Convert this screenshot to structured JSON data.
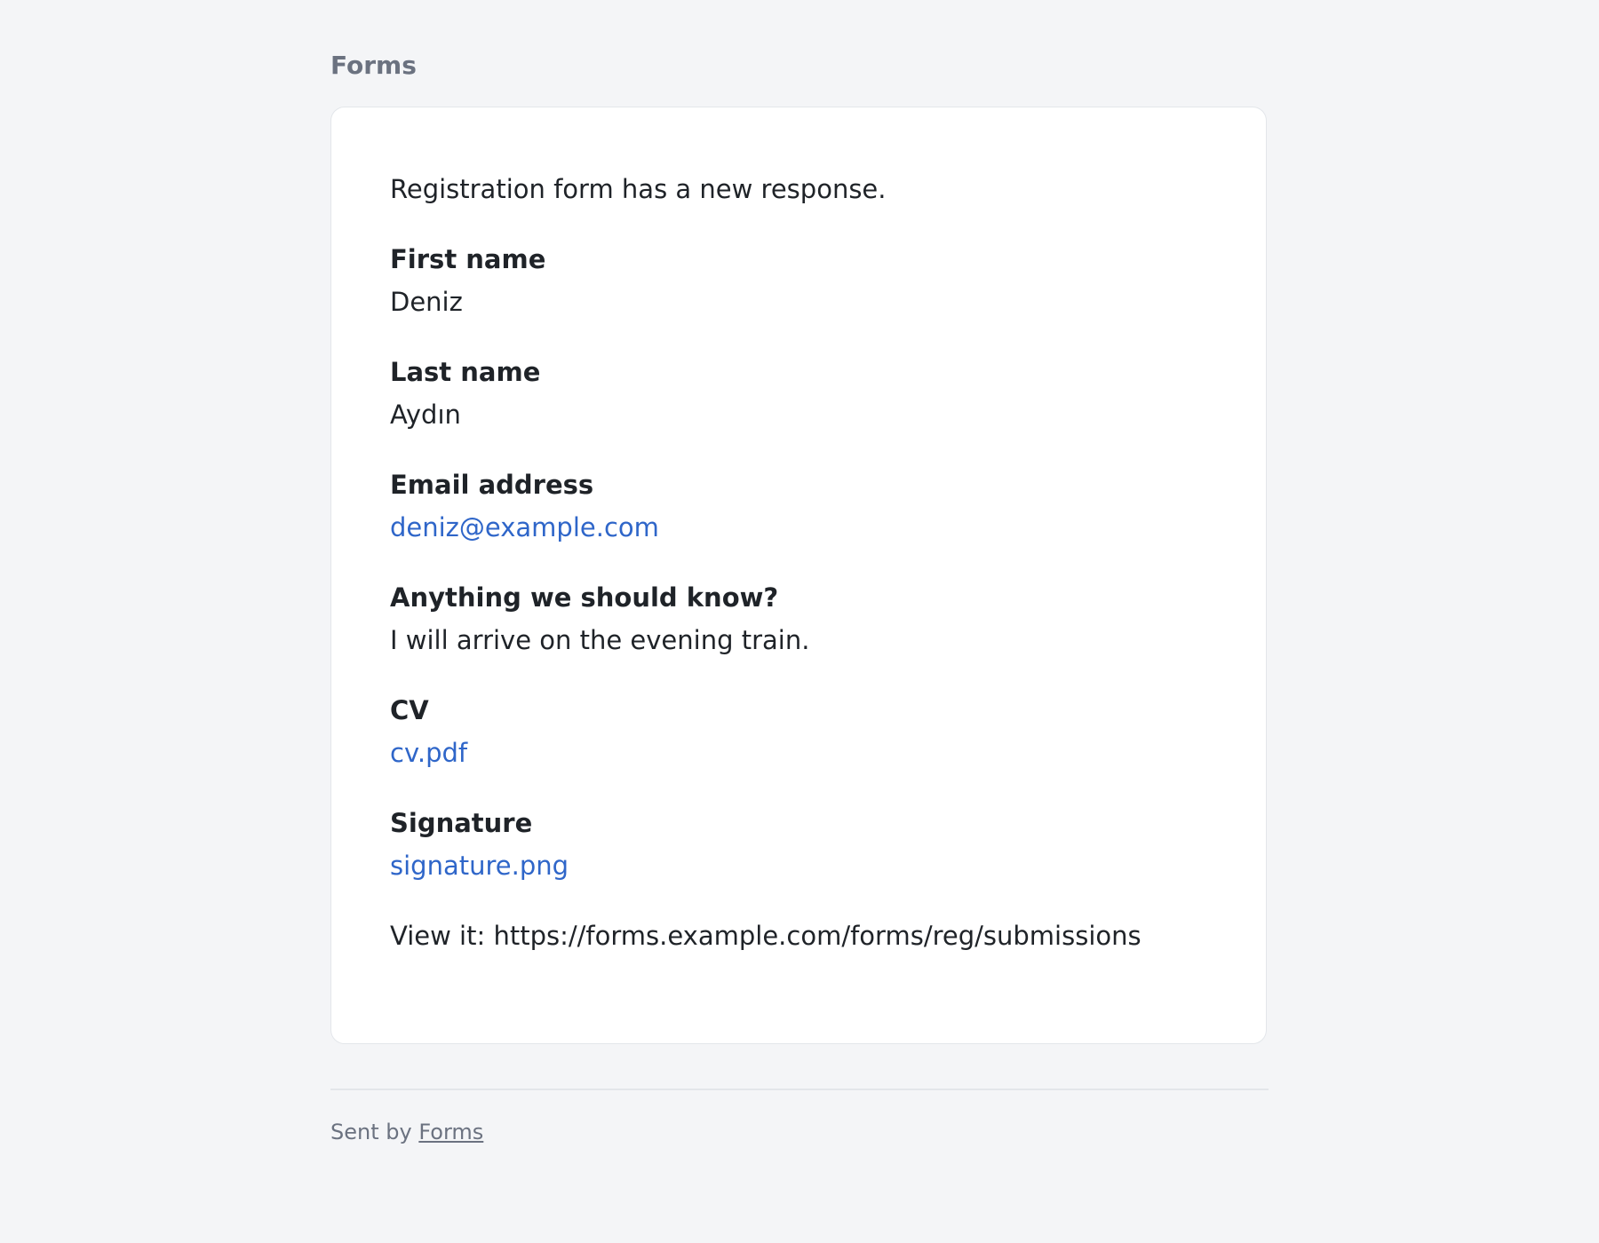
{
  "header": {
    "brand": "Forms"
  },
  "message": {
    "intro": "Registration form has a new response.",
    "fields": [
      {
        "label": "First name",
        "value": "Deniz",
        "is_link": false
      },
      {
        "label": "Last name",
        "value": "Aydın",
        "is_link": false
      },
      {
        "label": "Email address",
        "value": "deniz@example.com",
        "is_link": true
      },
      {
        "label": "Anything we should know?",
        "value": "I will arrive on the evening train.",
        "is_link": false
      },
      {
        "label": "CV",
        "value": "cv.pdf",
        "is_link": true
      },
      {
        "label": "Signature",
        "value": "signature.png",
        "is_link": true
      }
    ],
    "view_prefix": "View it: ",
    "view_url": "https://forms.example.com/forms/reg/submissions"
  },
  "footer": {
    "sent_by": "Sent by ",
    "link_label": "Forms"
  },
  "colors": {
    "background": "#f4f5f7",
    "card": "#ffffff",
    "link": "#2f66c9",
    "muted": "#6b7280",
    "text": "#1f2328"
  }
}
